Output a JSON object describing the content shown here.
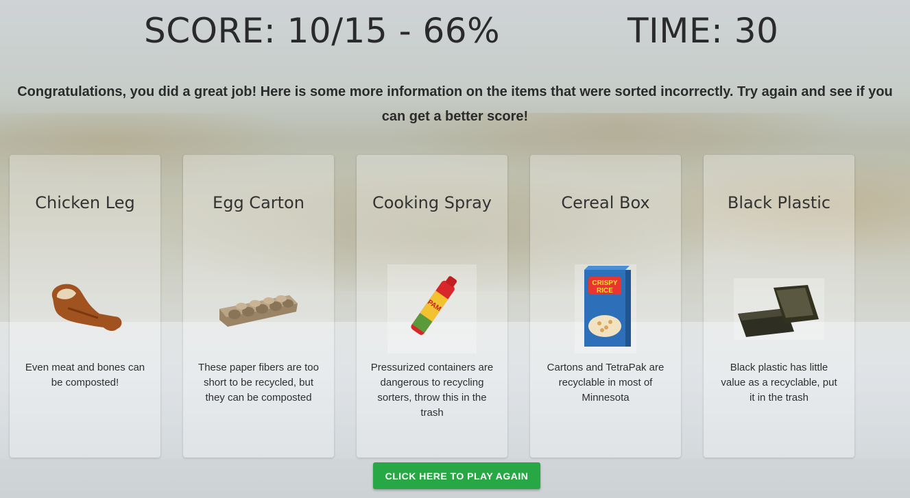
{
  "header": {
    "score": "SCORE: 10/15 - 66%",
    "time": "TIME: 30"
  },
  "message": "Congratulations, you did a great job! Here is some more information on the items that were sorted incorrectly. Try again and see if you can get a better score!",
  "cards": [
    {
      "title": "Chicken Leg",
      "description": "Even meat and bones can be composted!",
      "icon": "chicken-leg-icon"
    },
    {
      "title": "Egg Carton",
      "description": "These paper fibers are too short to be recycled, but they can be composted",
      "icon": "egg-carton-icon"
    },
    {
      "title": "Cooking Spray",
      "description": "Pressurized containers are dangerous to recycling sorters, throw this in the trash",
      "icon": "cooking-spray-icon"
    },
    {
      "title": "Cereal Box",
      "description": "Cartons and TetraPak are recyclable in most of Minnesota",
      "icon": "cereal-box-icon"
    },
    {
      "title": "Black Plastic",
      "description": "Black plastic has little value as a recyclable, put it in the trash",
      "icon": "black-plastic-tray-icon"
    }
  ],
  "play_again_label": "CLICK HERE TO PLAY AGAIN",
  "colors": {
    "button": "#28a745",
    "text": "#2b2b2b"
  }
}
